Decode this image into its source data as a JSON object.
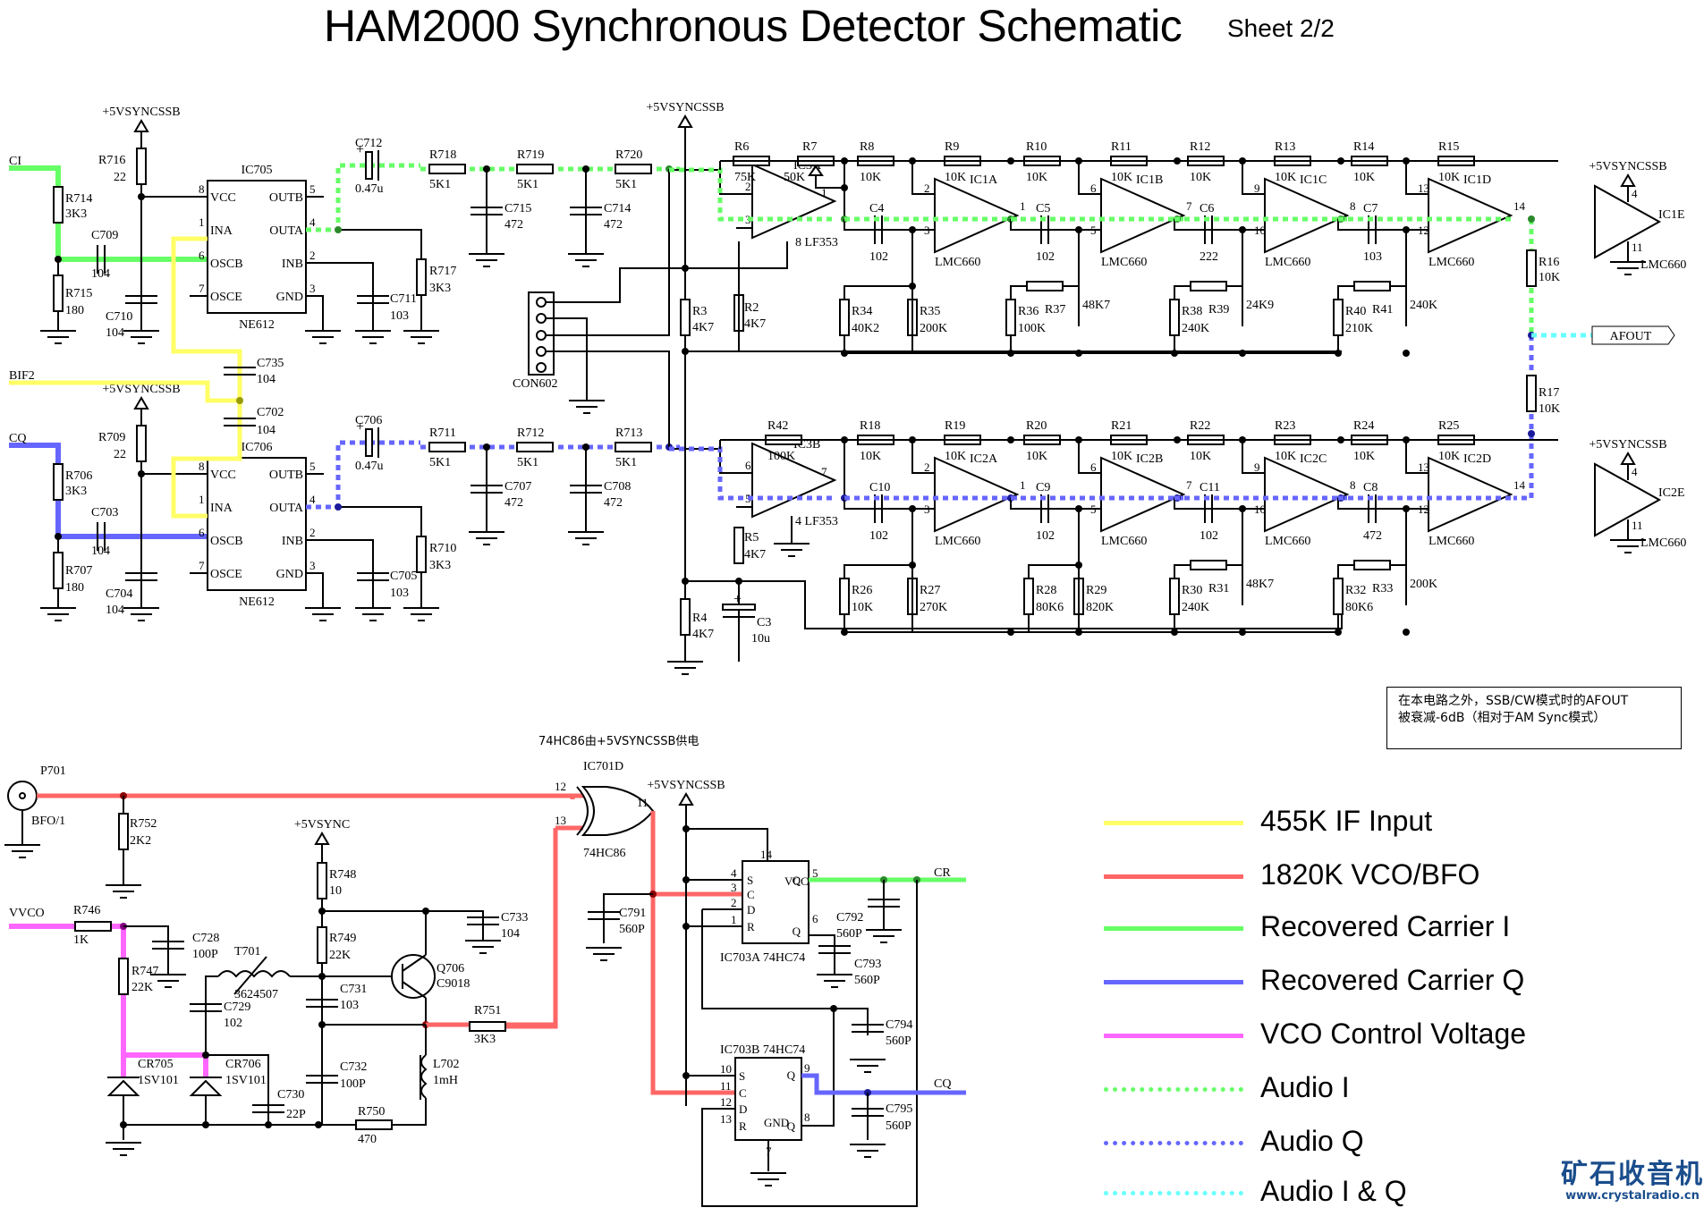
{
  "header": {
    "title": "HAM2000 Synchronous Detector Schematic",
    "sheet": "Sheet 2/2"
  },
  "note": {
    "line1": "在本电路之外，SSB/CW模式时的AFOUT",
    "line2": "被衰减-6dB（相对于AM Sync模式）"
  },
  "supply_note": "74HC86由+5VSYNCSSB供电",
  "legend": [
    {
      "label": "455K IF Input",
      "color": "#ffff66",
      "style": "solid"
    },
    {
      "label": "1820K VCO/BFO",
      "color": "#ff6666",
      "style": "solid"
    },
    {
      "label": "Recovered Carrier I",
      "color": "#66ff66",
      "style": "solid"
    },
    {
      "label": "Recovered Carrier Q",
      "color": "#6666ff",
      "style": "solid"
    },
    {
      "label": "VCO Control Voltage",
      "color": "#ff66ff",
      "style": "solid"
    },
    {
      "label": "Audio I",
      "color": "#66ff66",
      "style": "dotted"
    },
    {
      "label": "Audio Q",
      "color": "#6666ff",
      "style": "dotted"
    },
    {
      "label": "Audio I & Q",
      "color": "#66ffff",
      "style": "dotted"
    }
  ],
  "watermark": {
    "name": "矿石收音机",
    "url": "www.crystalradio.cn"
  },
  "nets": {
    "ci": "CI",
    "cq": "CQ",
    "bif2": "BIF2",
    "vvco": "VVCO",
    "cr": "CR",
    "cq_out": "CQ",
    "afout": "AFOUT",
    "bfo": "BFO/1",
    "p701": "P701",
    "supply_ssb": "+5VSYNCSSB",
    "supply_sync": "+5VSYNC"
  },
  "mixers": [
    {
      "ref": "IC705",
      "part": "NE612",
      "pins": {
        "vcc": "VCC",
        "ina": "INA",
        "oscb": "OSCB",
        "osce": "OSCE",
        "outb": "OUTB",
        "outa": "OUTA",
        "inb": "INB",
        "gnd": "GND"
      },
      "pin_nums": [
        "8",
        "1",
        "6",
        "7",
        "5",
        "4",
        "2",
        "3"
      ],
      "parts": {
        "r_series": [
          "R714",
          "3K3"
        ],
        "r_shunt": [
          "R715",
          "180"
        ],
        "r_vcc": [
          "R716",
          "22"
        ],
        "c_osc": [
          "C709",
          "104"
        ],
        "c_vcc": [
          "C710",
          "104"
        ],
        "c_inb": [
          "C711",
          "103"
        ],
        "r_out": [
          "R717",
          "3K3"
        ],
        "c_out": [
          "C712",
          "0.47u"
        ]
      }
    },
    {
      "ref": "IC706",
      "part": "NE612",
      "pins": {
        "vcc": "VCC",
        "ina": "INA",
        "oscb": "OSCB",
        "osce": "OSCE",
        "outb": "OUTB",
        "outa": "OUTA",
        "inb": "INB",
        "gnd": "GND"
      },
      "pin_nums": [
        "8",
        "1",
        "6",
        "7",
        "5",
        "4",
        "2",
        "3"
      ],
      "parts": {
        "r_series": [
          "R706",
          "3K3"
        ],
        "r_shunt": [
          "R707",
          "180"
        ],
        "r_vcc": [
          "R709",
          "22"
        ],
        "c_osc": [
          "C703",
          "104"
        ],
        "c_vcc": [
          "C704",
          "104"
        ],
        "c_inb": [
          "C705",
          "103"
        ],
        "r_out": [
          "R710",
          "3K3"
        ],
        "c_out": [
          "C706",
          "0.47u"
        ]
      }
    }
  ],
  "if_caps": [
    [
      "C735",
      "104"
    ],
    [
      "C702",
      "104"
    ]
  ],
  "rc_filter_i": {
    "r": [
      [
        "R718",
        "5K1"
      ],
      [
        "R719",
        "5K1"
      ],
      [
        "R720",
        "5K1"
      ]
    ],
    "c": [
      [
        "C715",
        "472"
      ],
      [
        "C714",
        "472"
      ]
    ]
  },
  "rc_filter_q": {
    "r": [
      [
        "R711",
        "5K1"
      ],
      [
        "R712",
        "5K1"
      ],
      [
        "R713",
        "5K1"
      ]
    ],
    "c": [
      [
        "C707",
        "472"
      ],
      [
        "C708",
        "472"
      ]
    ]
  },
  "connector": "CON602",
  "bias": {
    "r3": [
      "R3",
      "4K7"
    ],
    "r4": [
      "R4",
      "4K7"
    ],
    "r2": [
      "R2",
      "4K7"
    ],
    "r5": [
      "R5",
      "4K7"
    ],
    "c3": [
      "C3",
      "10u"
    ]
  },
  "chain_i": {
    "first": {
      "ref": "IC3A",
      "part": "LF353",
      "pins": [
        "2",
        "3",
        "1",
        "8"
      ],
      "rf": [
        "R6",
        "75K"
      ],
      "pot": [
        "R7",
        "50K"
      ]
    },
    "stages": [
      {
        "ref": "IC1A",
        "part": "LMC660",
        "pins": [
          "2",
          "3",
          "1"
        ],
        "r_in": [
          "R8",
          "10K"
        ],
        "r_fb": [
          "R9",
          "10K"
        ],
        "c": [
          "C4",
          "102"
        ],
        "ra": [
          "R34",
          "40K2"
        ],
        "rb": [
          "R35",
          "200K"
        ]
      },
      {
        "ref": "IC1B",
        "part": "LMC660",
        "pins": [
          "6",
          "5",
          "7"
        ],
        "r_in": [
          "R10",
          "10K"
        ],
        "r_fb": [
          "R11",
          "10K"
        ],
        "c": [
          "C5",
          "102"
        ],
        "ra": [
          "R36",
          "100K"
        ],
        "rb": [
          "R37",
          "48K7"
        ]
      },
      {
        "ref": "IC1C",
        "part": "LMC660",
        "pins": [
          "9",
          "10",
          "8"
        ],
        "r_in": [
          "R12",
          "10K"
        ],
        "r_fb": [
          "R13",
          "10K"
        ],
        "c": [
          "C6",
          "222"
        ],
        "ra": [
          "R38",
          "240K"
        ],
        "rb": [
          "R39",
          "24K9"
        ]
      },
      {
        "ref": "IC1D",
        "part": "LMC660",
        "pins": [
          "13",
          "12",
          "14"
        ],
        "r_in": [
          "R14",
          "10K"
        ],
        "r_fb": [
          "R15",
          "10K"
        ],
        "c": [
          "C7",
          "103"
        ],
        "ra": [
          "R40",
          "210K"
        ],
        "rb": [
          "R41",
          "240K"
        ]
      }
    ],
    "out_r": [
      "R16",
      "10K"
    ],
    "power": {
      "ref": "IC1E",
      "part": "LMC660",
      "pins": [
        "4",
        "11"
      ]
    }
  },
  "chain_q": {
    "first": {
      "ref": "IC3B",
      "part": "LF353",
      "pins": [
        "6",
        "5",
        "7",
        "4"
      ],
      "rf": [
        "R42",
        "100K"
      ]
    },
    "stages": [
      {
        "ref": "IC2A",
        "part": "LMC660",
        "pins": [
          "2",
          "3",
          "1"
        ],
        "r_in": [
          "R18",
          "10K"
        ],
        "r_fb": [
          "R19",
          "10K"
        ],
        "c": [
          "C10",
          "102"
        ],
        "ra": [
          "R26",
          "10K"
        ],
        "rb": [
          "R27",
          "270K"
        ]
      },
      {
        "ref": "IC2B",
        "part": "LMC660",
        "pins": [
          "6",
          "5",
          "7"
        ],
        "r_in": [
          "R20",
          "10K"
        ],
        "r_fb": [
          "R21",
          "10K"
        ],
        "c": [
          "C9",
          "102"
        ],
        "ra": [
          "R28",
          "80K6"
        ],
        "rb": [
          "R29",
          "820K"
        ]
      },
      {
        "ref": "IC2C",
        "part": "LMC660",
        "pins": [
          "9",
          "10",
          "8"
        ],
        "r_in": [
          "R22",
          "10K"
        ],
        "r_fb": [
          "R23",
          "10K"
        ],
        "c": [
          "C11",
          "102"
        ],
        "ra": [
          "R30",
          "240K"
        ],
        "rb": [
          "R31",
          "48K7"
        ]
      },
      {
        "ref": "IC2D",
        "part": "LMC660",
        "pins": [
          "13",
          "12",
          "14"
        ],
        "r_in": [
          "R24",
          "10K"
        ],
        "r_fb": [
          "R25",
          "10K"
        ],
        "c": [
          "C8",
          "472"
        ],
        "ra": [
          "R32",
          "80K6"
        ],
        "rb": [
          "R33",
          "200K"
        ]
      }
    ],
    "out_r": [
      "R17",
      "10K"
    ],
    "power": {
      "ref": "IC2E",
      "part": "LMC660",
      "pins": [
        "4",
        "11"
      ]
    }
  },
  "vco": {
    "r752": [
      "R752",
      "2K2"
    ],
    "r746": [
      "R746",
      "1K"
    ],
    "r747": [
      "R747",
      "22K"
    ],
    "c728": [
      "C728",
      "100P"
    ],
    "t701": [
      "T701",
      "3624507"
    ],
    "c729": [
      "C729",
      "102"
    ],
    "cr705": [
      "CR705",
      "1SV101"
    ],
    "cr706": [
      "CR706",
      "1SV101"
    ],
    "c730": [
      "C730",
      "22P"
    ],
    "r748": [
      "R748",
      "10"
    ],
    "r749": [
      "R749",
      "22K"
    ],
    "c733": [
      "C733",
      "104"
    ],
    "q706": [
      "Q706",
      "C9018"
    ],
    "c731": [
      "C731",
      "103"
    ],
    "c732": [
      "C732",
      "100P"
    ],
    "r750": [
      "R750",
      "470"
    ],
    "l702": [
      "L702",
      "1mH"
    ],
    "r751": [
      "R751",
      "3K3"
    ]
  },
  "xor": {
    "ref": "IC701D",
    "part": "74HC86",
    "pins": [
      "12",
      "13",
      "11"
    ]
  },
  "ff_a": {
    "ref": "IC703A 74HC74",
    "pins": {
      "s": "4",
      "c": "3",
      "d": "2",
      "r": "1",
      "q": "5",
      "qn": "6",
      "vcc": "14"
    },
    "labels": {
      "s": "S",
      "c": "C",
      "d": "D",
      "r": "R",
      "q": "Q",
      "qn": "Q",
      "vcc": "VCC"
    }
  },
  "ff_b": {
    "ref": "IC703B 74HC74",
    "pins": {
      "s": "10",
      "c": "11",
      "d": "12",
      "r": "13",
      "q": "9",
      "qn": "8",
      "gnd": "7"
    },
    "labels": {
      "s": "S",
      "c": "C",
      "d": "D",
      "r": "R",
      "q": "Q",
      "qn": "Q",
      "gnd": "GND"
    }
  },
  "ff_caps": [
    [
      "C791",
      "560P"
    ],
    [
      "C792",
      "560P"
    ],
    [
      "C793",
      "560P"
    ],
    [
      "C794",
      "560P"
    ],
    [
      "C795",
      "560P"
    ]
  ]
}
